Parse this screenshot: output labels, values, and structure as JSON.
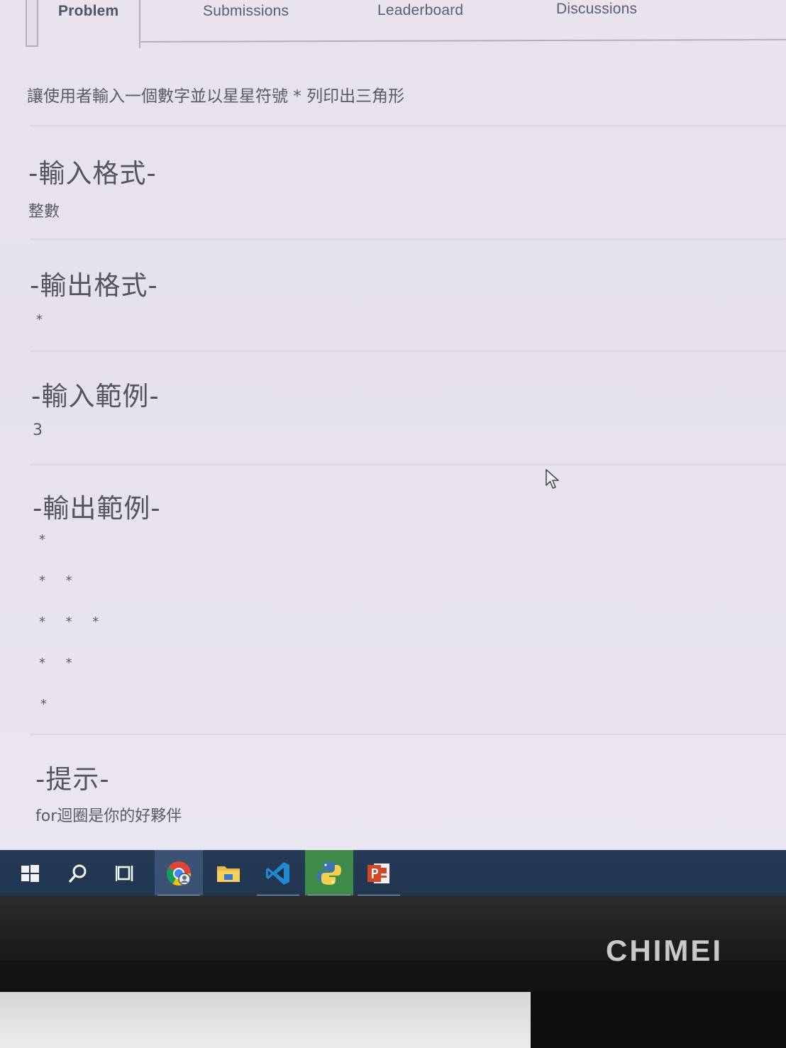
{
  "tabs": [
    {
      "label": "Problem",
      "active": true
    },
    {
      "label": "Submissions",
      "active": false
    },
    {
      "label": "Leaderboard",
      "active": false
    },
    {
      "label": "Discussions",
      "active": false
    }
  ],
  "problem": {
    "description": "讓使用者輸入一個數字並以星星符號 * 列印出三角形",
    "input_format": {
      "title": "-輸入格式-",
      "value": "整數"
    },
    "output_format": {
      "title": "-輸出格式-",
      "value": "*"
    },
    "input_example": {
      "title": "-輸入範例-",
      "value": "3"
    },
    "output_example": {
      "title": "-輸出範例-",
      "lines": [
        "*",
        "* *",
        "* * *",
        "* *",
        "*"
      ]
    },
    "hint": {
      "title": "-提示-",
      "value": "for迴圈是你的好夥伴"
    }
  },
  "taskbar": {
    "items": [
      {
        "name": "start",
        "icon": "windows-icon"
      },
      {
        "name": "search",
        "icon": "search-icon"
      },
      {
        "name": "task-view",
        "icon": "task-view-icon"
      },
      {
        "name": "chrome",
        "icon": "chrome-icon",
        "active": true
      },
      {
        "name": "file-explorer",
        "icon": "folder-icon"
      },
      {
        "name": "vscode",
        "icon": "vscode-icon",
        "running": true
      },
      {
        "name": "python-idle",
        "icon": "python-icon",
        "running": true
      },
      {
        "name": "powerpoint",
        "icon": "powerpoint-icon",
        "running": true
      }
    ]
  },
  "monitor": {
    "brand": "CHIMEI"
  },
  "colors": {
    "page_bg": "#e8e3ec",
    "text": "#5b5a66",
    "tab_text": "#5a5e78",
    "taskbar": "#22385a",
    "bezel": "#1f1f20"
  }
}
